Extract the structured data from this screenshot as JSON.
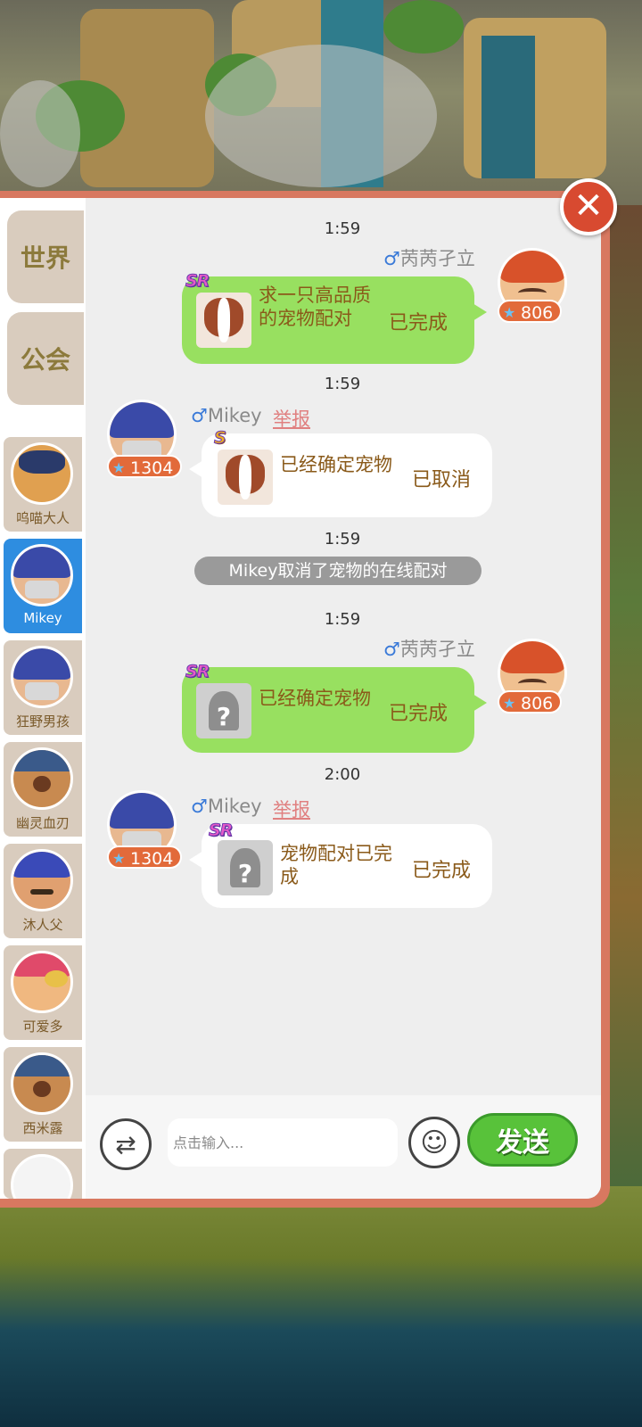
{
  "sidebar": {
    "tabs": [
      {
        "label": "世界"
      },
      {
        "label": "公会"
      }
    ],
    "contacts": [
      {
        "name": "呜喵大人",
        "avatar": "cat-detective-avatar"
      },
      {
        "name": "Mikey",
        "avatar": "blue-helmet-avatar",
        "active": true
      },
      {
        "name": "狂野男孩",
        "avatar": "blue-helmet-avatar"
      },
      {
        "name": "幽灵血刃",
        "avatar": "brown-mustache-avatar"
      },
      {
        "name": "沐人父",
        "avatar": "blue-beanie-avatar"
      },
      {
        "name": "可爱多",
        "avatar": "pink-cap-avatar"
      },
      {
        "name": "西米露",
        "avatar": "brown-mustache-avatar"
      }
    ]
  },
  "messages": [
    {
      "time": "1:59",
      "sender": "苪苪孑立",
      "gender": "♂",
      "level": "806",
      "side": "right",
      "rarity": "SR",
      "pet": "french-bulldog",
      "text": "求一只高品质的宠物配对",
      "status": "已完成"
    },
    {
      "time": "1:59",
      "sender": "Mikey",
      "gender": "♂",
      "level": "1304",
      "side": "left",
      "report": "举报",
      "rarity": "S",
      "pet": "french-bulldog",
      "text": "已经确定宠物",
      "status": "已取消"
    },
    {
      "time": "1:59",
      "system": "Mikey取消了宠物的在线配对"
    },
    {
      "time": "1:59",
      "sender": "苪苪孑立",
      "gender": "♂",
      "level": "806",
      "side": "right",
      "rarity": "SR",
      "pet": "unknown",
      "unknown_mark": "?",
      "text": "已经确定宠物",
      "status": "已完成"
    },
    {
      "time": "2:00",
      "sender": "Mikey",
      "gender": "♂",
      "level": "1304",
      "side": "left",
      "report": "举报",
      "rarity": "SR",
      "pet": "unknown",
      "unknown_mark": "?",
      "text": "宠物配对已完成",
      "status": "已完成"
    }
  ],
  "input": {
    "placeholder": "点击输入...",
    "swap_icon": "⇄",
    "emoji_icon": "☺",
    "send_label": "发送"
  },
  "close_icon": "✕",
  "level_star": "★",
  "colors": {
    "panel_border": "#d87860",
    "my_bubble": "#98e060",
    "other_bubble": "#ffffff",
    "active_contact": "#2e8de0",
    "send_button": "#58c23a",
    "close_button": "#d84a30"
  }
}
